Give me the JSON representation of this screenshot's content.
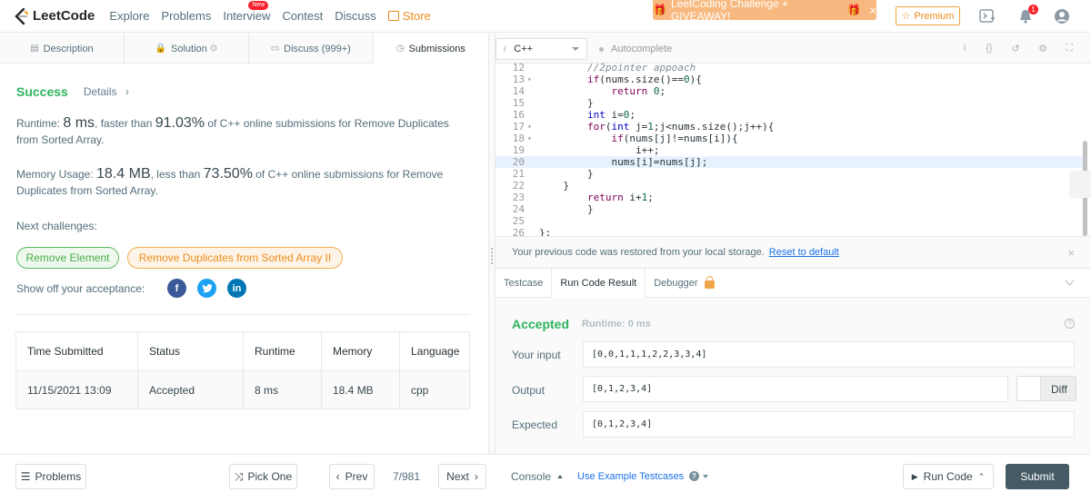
{
  "nav": {
    "logo_text": "LeetCode",
    "items": [
      "Explore",
      "Problems",
      "Interview",
      "Contest",
      "Discuss"
    ],
    "new_badge": "New",
    "store": "Store",
    "promo": "LeetCoding Challenge + GIVEAWAY!",
    "promo_close": "×",
    "premium": "Premium",
    "notification_count": "1"
  },
  "left_tabs": {
    "description": "Description",
    "solution": "Solution",
    "discuss": "Discuss (999+)",
    "submissions": "Submissions"
  },
  "result": {
    "status": "Success",
    "details": "Details",
    "runtime_prefix": "Runtime: ",
    "runtime_value": "8 ms",
    "runtime_mid": ", faster than ",
    "runtime_pct": "91.03%",
    "runtime_suffix": " of C++ online submissions for Remove Duplicates from Sorted Array.",
    "memory_prefix": "Memory Usage: ",
    "memory_value": "18.4 MB",
    "memory_mid": ", less than ",
    "memory_pct": "73.50%",
    "memory_suffix": " of C++ online submissions for Remove Duplicates from Sorted Array.",
    "next_label": "Next challenges:",
    "challenge_1": "Remove Element",
    "challenge_2": "Remove Duplicates from Sorted Array II",
    "share_label": "Show off your acceptance:"
  },
  "table": {
    "headers": [
      "Time Submitted",
      "Status",
      "Runtime",
      "Memory",
      "Language"
    ],
    "rows": [
      [
        "11/15/2021 13:09",
        "Accepted",
        "8 ms",
        "18.4 MB",
        "cpp"
      ]
    ]
  },
  "editor": {
    "language": "C++",
    "lang_icon": "i",
    "autocomplete": "Autocomplete",
    "lines": [
      {
        "n": "12",
        "fold": "",
        "code": "        //2pointer appoach"
      },
      {
        "n": "13",
        "fold": "▾",
        "code": "        if(nums.size()==0){"
      },
      {
        "n": "14",
        "fold": "",
        "code": "            return 0;"
      },
      {
        "n": "15",
        "fold": "",
        "code": "        }"
      },
      {
        "n": "16",
        "fold": "",
        "code": "        int i=0;"
      },
      {
        "n": "17",
        "fold": "▾",
        "code": "        for(int j=1;j<nums.size();j++){"
      },
      {
        "n": "18",
        "fold": "▾",
        "code": "            if(nums[j]!=nums[i]){"
      },
      {
        "n": "19",
        "fold": "",
        "code": "                i++;"
      },
      {
        "n": "20",
        "fold": "",
        "code": "            nums[i]=nums[j];"
      },
      {
        "n": "21",
        "fold": "",
        "code": "        }"
      },
      {
        "n": "22",
        "fold": "",
        "code": "    }"
      },
      {
        "n": "23",
        "fold": "",
        "code": "        return i+1;"
      },
      {
        "n": "24",
        "fold": "",
        "code": "        }"
      },
      {
        "n": "25",
        "fold": "",
        "code": ""
      },
      {
        "n": "26",
        "fold": "",
        "code": "};"
      }
    ],
    "highlight_line": "20"
  },
  "restore": {
    "message": "Your previous code was restored from your local storage.",
    "reset": "Reset to default",
    "close": "×"
  },
  "bottom_tabs": {
    "testcase": "Testcase",
    "run_result": "Run Code Result",
    "debugger": "Debugger"
  },
  "run_result": {
    "status": "Accepted",
    "runtime": "Runtime: 0 ms",
    "help": "?",
    "input_label": "Your input",
    "input_value": "[0,0,1,1,1,2,2,3,3,4]",
    "output_label": "Output",
    "output_value": "[0,1,2,3,4]",
    "expected_label": "Expected",
    "expected_value": "[0,1,2,3,4]",
    "diff": "Diff"
  },
  "footer": {
    "problems": "Problems",
    "pick_one": "Pick One",
    "prev": "Prev",
    "page": "7/981",
    "next": "Next",
    "console": "Console",
    "use_example": "Use Example Testcases",
    "help": "?",
    "run_code": "Run Code",
    "submit": "Submit"
  },
  "colors": {
    "success": "#2db55d",
    "accent_orange": "#ef8c1d",
    "link_blue": "#1a73e8",
    "submit_bg": "#455a64",
    "facebook": "#3b5998",
    "twitter": "#1da1f2",
    "linkedin": "#0077b5"
  },
  "icons": [
    "leetcode-logo-icon",
    "store-icon",
    "gift-icon",
    "star-icon",
    "playlist-icon",
    "bell-icon",
    "user-icon",
    "document-icon",
    "lock-icon",
    "chat-icon",
    "history-icon",
    "info-icon",
    "braces-icon",
    "undo-icon",
    "settings-icon",
    "fullscreen-icon",
    "facebook-icon",
    "twitter-icon",
    "linkedin-icon",
    "list-icon",
    "shuffle-icon",
    "chevron-left-icon",
    "chevron-right-icon",
    "play-icon"
  ]
}
